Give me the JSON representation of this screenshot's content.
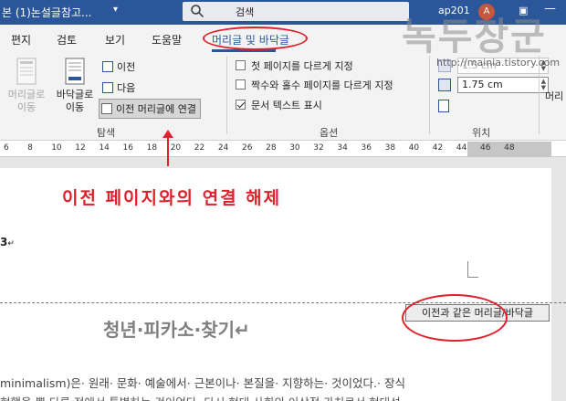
{
  "titlebar": {
    "doc_title": "본 (1)논설글참고...",
    "search_label": "검색",
    "account": "ap201",
    "avatar_initial": "A",
    "accent": "#2b579a"
  },
  "tabs": [
    {
      "label": "편지"
    },
    {
      "label": "검토"
    },
    {
      "label": "보기"
    },
    {
      "label": "도움말"
    },
    {
      "label": "머리글 및 바닥글"
    }
  ],
  "ribbon": {
    "nav": {
      "goto_header": "머리글로\n이동",
      "goto_footer": "바닥글로\n이동",
      "previous": "이전",
      "next": "다음",
      "link_to_previous": "이전 머리글에 연결",
      "group_label": "탐색"
    },
    "options": {
      "different_first": "첫 페이지를 다르게 지정",
      "different_odd_even": "짝수와 홀수 페이지를 다르게 지정",
      "show_doc_text": "문서 텍스트 표시",
      "group_label": "옵션"
    },
    "position": {
      "header_from_top": "1.5 cm",
      "footer_from_bottom": "1.75 cm",
      "group_label": "위치",
      "cut_label": "머리"
    }
  },
  "ruler": {
    "ticks": [
      "6",
      "8",
      "10",
      "12",
      "14",
      "16",
      "18",
      "20",
      "22",
      "24",
      "26",
      "28",
      "30",
      "32",
      "34",
      "36",
      "38",
      "40",
      "42",
      "44",
      "46",
      "48"
    ]
  },
  "annotation": {
    "text": "이전 페이지와의 연결 해제",
    "color": "#e0202a"
  },
  "document": {
    "header_number": "3",
    "same_as_previous_tab": "이전과 같은 머리글/바닥글",
    "heading": "청년·피카소·찾기↵",
    "line1": "minimalism)은· 원래· 문화· 예술에서· 근본이나· 본질을· 지향하는· 것이었다.· 장식",
    "line2": "현했을·뿐·다른·전에서·특별하는·것이었다.·다시·현대·사회의·이상적·가치로서·현대성"
  },
  "watermark": {
    "text": "녹두장군",
    "url": "http://mainia.tistory.com"
  }
}
